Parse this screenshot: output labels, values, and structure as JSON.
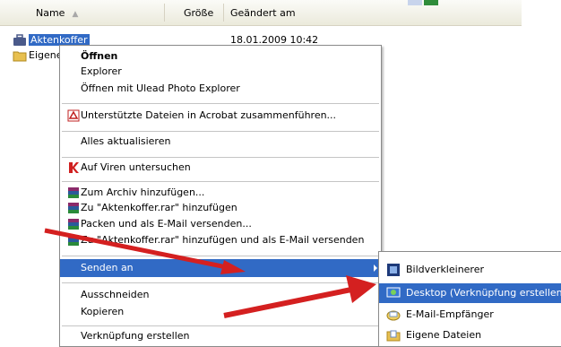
{
  "list": {
    "columns": {
      "name": "Name",
      "size": "Größe",
      "modified": "Geändert am"
    },
    "rows": [
      {
        "name": "Aktenkoffer",
        "date": "18.01.2009 10:42"
      },
      {
        "name": "Eigene"
      }
    ]
  },
  "menu": {
    "open": "Öffnen",
    "explorer": "Explorer",
    "open_with": "Öffnen mit Ulead Photo Explorer",
    "acrobat": "Unterstützte Dateien in Acrobat zusammenführen...",
    "refresh": "Alles aktualisieren",
    "virus": "Auf Viren untersuchen",
    "archive_add": "Zum Archiv hinzufügen...",
    "rar_add": "Zu \"Aktenkoffer.rar\" hinzufügen",
    "pack_mail": "Packen und als E-Mail versenden...",
    "rar_mail": "Zu \"Aktenkoffer.rar\" hinzufügen und als E-Mail versenden",
    "send_to": "Senden an",
    "cut": "Ausschneiden",
    "copy": "Kopieren",
    "shortcut": "Verknüpfung erstellen"
  },
  "submenu": {
    "resizer": "Bildverkleinerer",
    "desktop": "Desktop (Verknüpfung erstellen)",
    "mail": "E-Mail-Empfänger",
    "mydocs": "Eigene Dateien"
  },
  "colors": {
    "highlight": "#316ac5",
    "arrow": "#d42020"
  }
}
